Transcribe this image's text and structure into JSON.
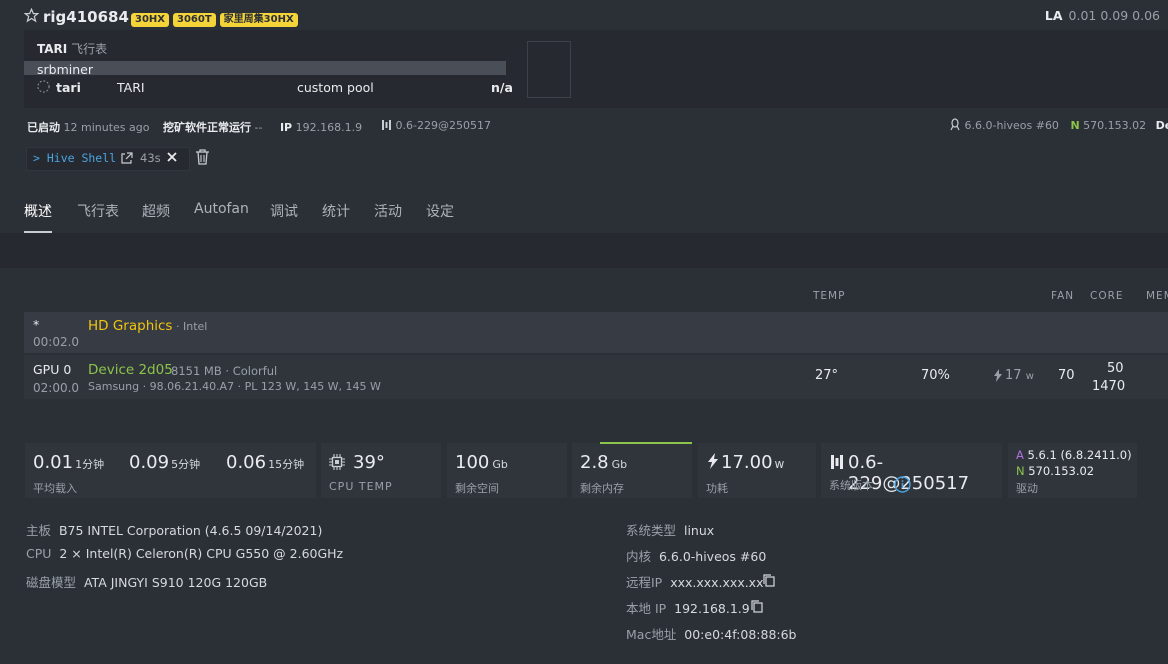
{
  "rig": {
    "name": "rig410684",
    "badges": [
      "30HX",
      "3060T",
      "家里周集30HX"
    ],
    "la_label": "LA",
    "la_values": "0.01 0.09 0.06"
  },
  "flightsheet": {
    "coin_label": "TARI",
    "fs_label": "飞行表",
    "miner": "srbminer",
    "coin": "tari",
    "algo": "TARI",
    "pool": "custom pool",
    "hashrate": "n/a"
  },
  "status": {
    "started_label": "已启动",
    "started_value": "12 minutes ago",
    "mining_label": "挖矿软件正常运行",
    "mining_value": "--",
    "ip_label": "IP",
    "ip_value": "192.168.1.9",
    "version": "0.6-229@250517",
    "kernel": "6.6.0-hiveos #60",
    "nvidia_letter": "N",
    "nvidia_driver": "570.153.02",
    "device_label": "Devic"
  },
  "hiveshell": {
    "label": "> Hive Shell",
    "timer": "43s"
  },
  "tabs": [
    "概述",
    "飞行表",
    "超频",
    "Autofan",
    "调试",
    "统计",
    "活动",
    "设定"
  ],
  "gpu_table": {
    "headers": {
      "temp": "TEMP",
      "fan": "FAN",
      "core": "CORE",
      "mem": "MEM"
    },
    "rows": [
      {
        "index": "*",
        "bus": "00:02.0",
        "name": "HD Graphics",
        "vendor": "· Intel"
      },
      {
        "index": "GPU 0",
        "bus": "02:00.0",
        "name": "Device 2d05",
        "mem": "8151 MB · Colorful",
        "sub": "Samsung · 98.06.21.40.A7 · PL 123 W, 145 W, 145 W",
        "temp": "27°",
        "fan": "70%",
        "power": "17",
        "power_unit": "w",
        "pl": "70",
        "core": "50",
        "mem_clock": "1470"
      }
    ]
  },
  "cards": {
    "la1": "0.01",
    "la1_unit": "1分钟",
    "la5": "0.09",
    "la5_unit": "5分钟",
    "la15": "0.06",
    "la15_unit": "15分钟",
    "la_label": "平均载入",
    "cpu_temp": "39°",
    "cpu_temp_label": "CPU TEMP",
    "disk": "100",
    "disk_unit": "Gb",
    "disk_label": "剩余空间",
    "ram": "2.8",
    "ram_unit": "Gb",
    "ram_label": "剩余内存",
    "power": "17.00",
    "power_unit": "w",
    "power_label": "功耗",
    "sysver": "0.6-229@250517",
    "sysver_label": "系统版本",
    "amd_letter": "A",
    "amd_driver": "5.6.1 (6.8.2411.0)",
    "nv_letter": "N",
    "nv_driver": "570.153.02",
    "driver_label": "驱动"
  },
  "info_left": [
    {
      "k": "主板",
      "v": "B75 INTEL Corporation (4.6.5 09/14/2021)"
    },
    {
      "k": "CPU",
      "v": "2 × Intel(R) Celeron(R) CPU G550 @ 2.60GHz"
    },
    {
      "k": "磁盘模型",
      "v": "ATA JINGYI S910 120G 120GB"
    }
  ],
  "info_right": [
    {
      "k": "系统类型",
      "v": "linux"
    },
    {
      "k": "内核",
      "v": "6.6.0-hiveos #60"
    },
    {
      "k": "远程IP",
      "v": "xxx.xxx.xxx.xx"
    },
    {
      "k": "本地 IP",
      "v": "192.168.1.9"
    },
    {
      "k": "Mac地址",
      "v": "00:e0:4f:08:88:6b"
    }
  ],
  "colors": {
    "bg": "#2b2f36",
    "panel": "#262a30",
    "accent_yellow": "#f5d43a",
    "gpu_green": "#8cc34a",
    "gpu_yellow": "#f1c40f",
    "link_blue": "#4aa3df",
    "amd_purple": "#b370e0"
  }
}
